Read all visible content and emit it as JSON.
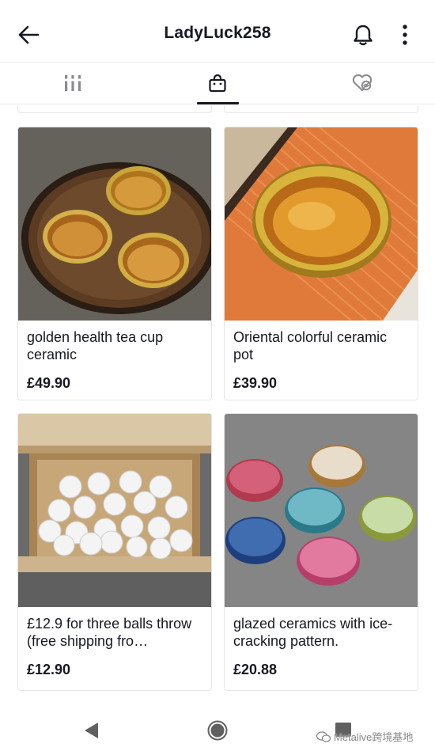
{
  "header": {
    "title": "LadyLuck258",
    "back_icon": "arrow-left-icon",
    "bell_icon": "bell-icon",
    "more_icon": "more-vertical-icon"
  },
  "tabs": [
    {
      "name": "videos",
      "icon": "grid-bars-icon",
      "selected": false
    },
    {
      "name": "shop",
      "icon": "shopping-bag-icon",
      "selected": true
    },
    {
      "name": "liked",
      "icon": "hidden-heart-icon",
      "selected": false
    }
  ],
  "products": [
    {
      "name": "golden health tea cup ceramic",
      "price": "£49.90"
    },
    {
      "name": "Oriental colorful ceramic pot",
      "price": "£39.90"
    },
    {
      "name": "£12.9 for three balls throw (free shipping fro…",
      "price": "£12.90"
    },
    {
      "name": "glazed ceramics with ice-cracking pattern.",
      "price": "£20.88"
    }
  ],
  "watermark": {
    "text": "Metalive跨境基地"
  },
  "colors": {
    "text": "#161823",
    "border": "#e6e6e6",
    "icon_inactive": "#8a8b91"
  }
}
